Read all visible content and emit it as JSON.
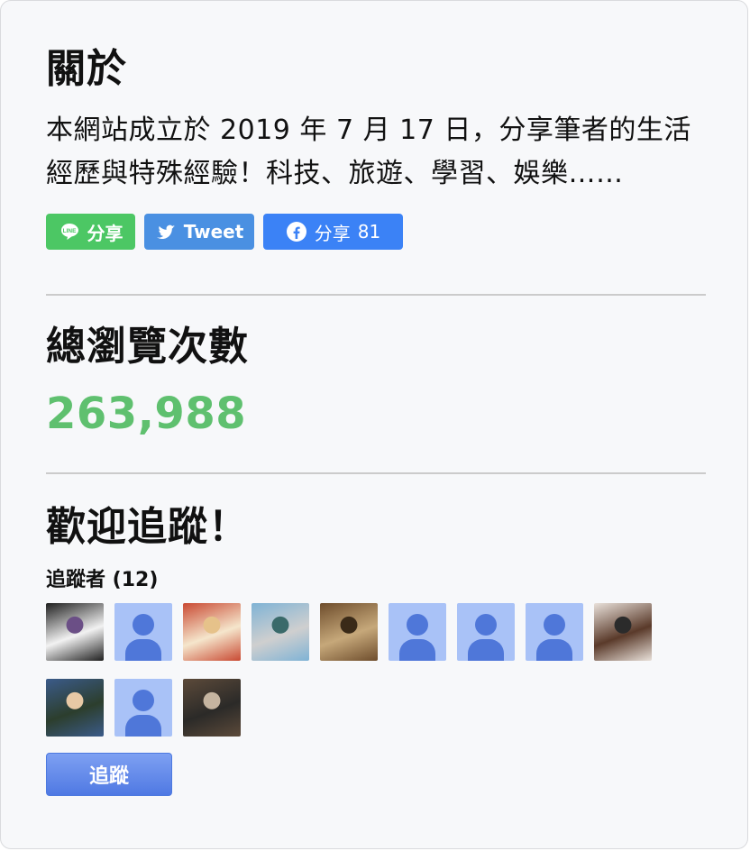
{
  "about": {
    "title": "關於",
    "description": "本網站成立於 2019 年 7 月 17 日，分享筆者的生活經歷與特殊經驗！科技、旅遊、學習、娛樂……",
    "share_buttons": {
      "line": {
        "label": "分享",
        "icon": "line-icon",
        "color": "#4cc764"
      },
      "twitter": {
        "label": "Tweet",
        "icon": "twitter-bird-icon",
        "color": "#4a90e2"
      },
      "facebook": {
        "label": "分享",
        "count": "81",
        "icon": "facebook-icon",
        "color": "#3b82f6"
      }
    }
  },
  "views": {
    "title": "總瀏覽次數",
    "count": "263,988",
    "count_color": "#5fc06f"
  },
  "follow": {
    "title": "歡迎追蹤！",
    "followers_label": "追蹤者 (12)",
    "button_label": "追蹤",
    "avatars": [
      {
        "kind": "photo",
        "palette": [
          "#1f1f1f",
          "#f2f2f2",
          "#6b4f86"
        ]
      },
      {
        "kind": "placeholder"
      },
      {
        "kind": "photo",
        "palette": [
          "#c94a33",
          "#f5e6cc",
          "#e6c28a"
        ]
      },
      {
        "kind": "photo",
        "palette": [
          "#7fb3d5",
          "#cfcfcf",
          "#3a6a6a"
        ]
      },
      {
        "kind": "photo",
        "palette": [
          "#6e4d2c",
          "#c6a87a",
          "#3a2a18"
        ]
      },
      {
        "kind": "placeholder"
      },
      {
        "kind": "placeholder"
      },
      {
        "kind": "placeholder"
      },
      {
        "kind": "photo",
        "palette": [
          "#e9e1da",
          "#5a3a2a",
          "#2b2b2b"
        ]
      },
      {
        "kind": "photo",
        "palette": [
          "#3b5b8a",
          "#2c3e2d",
          "#e8c9a5"
        ]
      },
      {
        "kind": "placeholder"
      },
      {
        "kind": "photo",
        "palette": [
          "#5c4a3a",
          "#2b2a28",
          "#c5b4a0"
        ]
      }
    ]
  }
}
